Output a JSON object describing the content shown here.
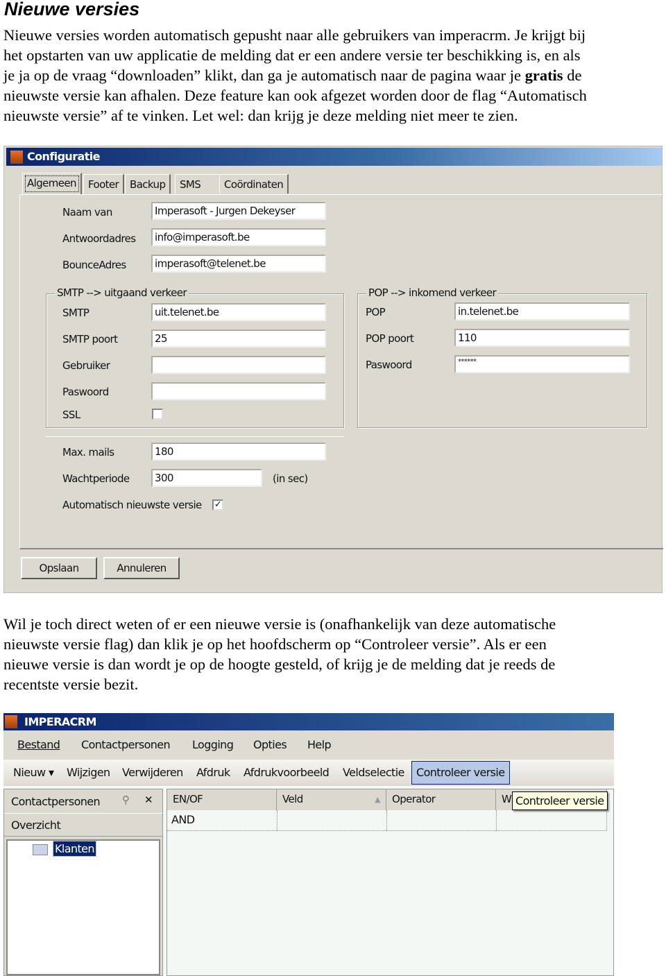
{
  "heading": "Nieuwe versies",
  "para1": {
    "l1": "Nieuwe versies worden automatisch gepusht naar alle gebruikers van imperacrm. Je krijgt bij",
    "l2": "het opstarten van uw applicatie de melding dat er een andere versie ter beschikking is, en als",
    "l3a": "je ja op de vraag “downloaden” klikt, dan ga je automatisch naar de pagina waar je ",
    "l3b": "gratis",
    "l3c": " de",
    "l4": "nieuwste versie kan afhalen. Deze feature kan ook afgezet worden door de flag “Automatisch",
    "l5": "nieuwste versie” af te vinken. Let wel: dan krijg je deze melding niet meer te zien."
  },
  "config": {
    "title": "Configuratie",
    "tabs": [
      "Algemeen",
      "Footer",
      "Backup",
      "SMS",
      "Coördinaten"
    ],
    "naam_label": "Naam van",
    "naam_value": "Imperasoft - Jurgen Dekeyser",
    "antwoord_label": "Antwoordadres",
    "antwoord_value": "info@imperasoft.be",
    "bounce_label": "BounceAdres",
    "bounce_value": "imperasoft@telenet.be",
    "smtp_group": "SMTP --> uitgaand verkeer",
    "smtp_label": "SMTP",
    "smtp_value": "uit.telenet.be",
    "smtp_port_label": "SMTP poort",
    "smtp_port_value": "25",
    "gebruiker_label": "Gebruiker",
    "gebruiker_value": "",
    "paswoord_label": "Paswoord",
    "paswoord_value": "",
    "ssl_label": "SSL",
    "ssl_checked": false,
    "pop_group": "POP --> inkomend verkeer",
    "pop_label": "POP",
    "pop_value": "in.telenet.be",
    "pop_port_label": "POP poort",
    "pop_port_value": "110",
    "pop_pw_label": "Paswoord",
    "pop_pw_value": "******",
    "max_label": "Max. mails",
    "max_value": "180",
    "wacht_label": "Wachtperiode",
    "wacht_value": "300",
    "wacht_unit": "(in sec)",
    "auto_label": "Automatisch nieuwste versie",
    "auto_checked": true,
    "check_mark": "✓",
    "save": "Opslaan",
    "cancel": "Annuleren"
  },
  "para2": {
    "l1": "Wil je toch direct weten of er een nieuwe versie is (onafhankelijk van deze automatische",
    "l2": "nieuwste versie flag) dan klik je op het hoofdscherm op “Controleer versie”. Als er een",
    "l3": "nieuwe versie is dan wordt je op de hoogte gesteld, of krijg je de melding dat je reeds de",
    "l4": "recentste versie bezit."
  },
  "crm": {
    "title": "IMPERACRM",
    "menu": [
      "Bestand",
      "Contactpersonen",
      "Logging",
      "Opties",
      "Help"
    ],
    "toolbar": [
      "Nieuw ▾",
      "Wijzigen",
      "Verwijderen",
      "Afdruk",
      "Afdrukvoorbeeld",
      "Veldselectie",
      "Controleer versie"
    ],
    "panel_title": "Contactpersonen",
    "close": "✕",
    "overzicht": "Overzicht",
    "tree_item": "Klanten",
    "columns": [
      "EN/OF",
      "Veld",
      "Operator",
      "W"
    ],
    "rows": [
      [
        "AND",
        "",
        "",
        ""
      ]
    ],
    "tooltip": "Controleer versie"
  }
}
